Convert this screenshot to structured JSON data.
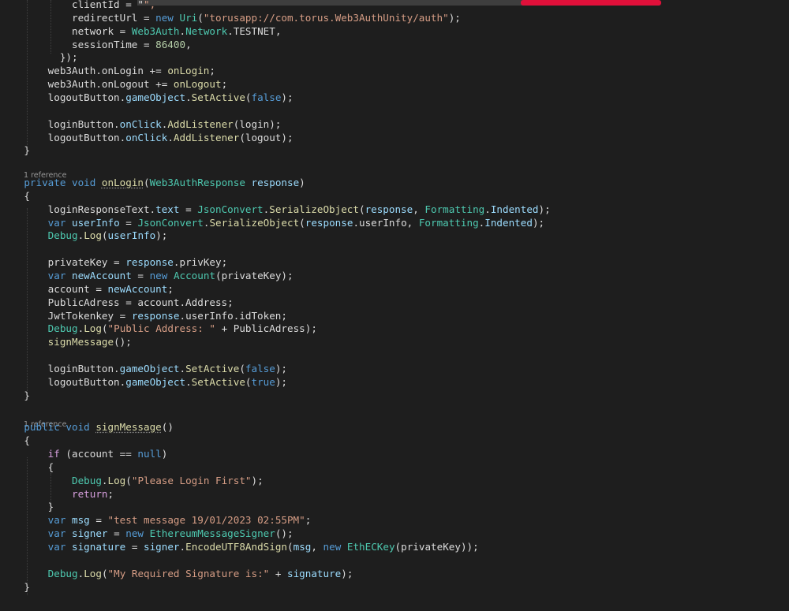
{
  "editor": {
    "code_lens": [
      "1 reference",
      "1 reference"
    ],
    "lines": [
      [
        {
          "t": "            clientId = \"",
          "c": "pl"
        },
        {
          "t": "\",",
          "c": "str"
        }
      ],
      [
        {
          "t": "            redirectUrl = ",
          "c": "pl"
        },
        {
          "t": "new ",
          "c": "kw"
        },
        {
          "t": "Uri",
          "c": "ty"
        },
        {
          "t": "(",
          "c": "pl"
        },
        {
          "t": "\"torusapp://com.torus.Web3AuthUnity/auth\"",
          "c": "str"
        },
        {
          "t": ");",
          "c": "pl"
        }
      ],
      [
        {
          "t": "            network = ",
          "c": "pl"
        },
        {
          "t": "Web3Auth",
          "c": "ty"
        },
        {
          "t": ".",
          "c": "pl"
        },
        {
          "t": "Network",
          "c": "ty"
        },
        {
          "t": ".TESTNET,",
          "c": "pl"
        }
      ],
      [
        {
          "t": "            sessionTime = ",
          "c": "pl"
        },
        {
          "t": "86400",
          "c": "num"
        },
        {
          "t": ",",
          "c": "pl"
        }
      ],
      [
        {
          "t": "          });",
          "c": "pl"
        }
      ],
      [
        {
          "t": "        web3Auth.onLogin += ",
          "c": "pl"
        },
        {
          "t": "onLogin",
          "c": "fn"
        },
        {
          "t": ";",
          "c": "pl"
        }
      ],
      [
        {
          "t": "        web3Auth.onLogout += ",
          "c": "pl"
        },
        {
          "t": "onLogout",
          "c": "fn"
        },
        {
          "t": ";",
          "c": "pl"
        }
      ],
      [
        {
          "t": "        logoutButton.",
          "c": "pl"
        },
        {
          "t": "gameObject",
          "c": "var"
        },
        {
          "t": ".",
          "c": "pl"
        },
        {
          "t": "SetActive",
          "c": "fn"
        },
        {
          "t": "(",
          "c": "pl"
        },
        {
          "t": "false",
          "c": "kw"
        },
        {
          "t": ");",
          "c": "pl"
        }
      ],
      [],
      [
        {
          "t": "        loginButton.",
          "c": "pl"
        },
        {
          "t": "onClick",
          "c": "var"
        },
        {
          "t": ".",
          "c": "pl"
        },
        {
          "t": "AddListener",
          "c": "fn"
        },
        {
          "t": "(login);",
          "c": "pl"
        }
      ],
      [
        {
          "t": "        logoutButton.",
          "c": "pl"
        },
        {
          "t": "onClick",
          "c": "var"
        },
        {
          "t": ".",
          "c": "pl"
        },
        {
          "t": "AddListener",
          "c": "fn"
        },
        {
          "t": "(logout);",
          "c": "pl"
        }
      ],
      [
        {
          "t": "    }",
          "c": "pl"
        }
      ],
      [],
      [
        {
          "t": "    ",
          "c": "pl"
        },
        {
          "t": "private void ",
          "c": "kw"
        },
        {
          "t": "onLogin",
          "c": "fn"
        },
        {
          "t": "(",
          "c": "pl"
        },
        {
          "t": "Web3AuthResponse ",
          "c": "ty"
        },
        {
          "t": "response",
          "c": "var"
        },
        {
          "t": ")",
          "c": "pl"
        }
      ],
      [
        {
          "t": "    {",
          "c": "pl"
        }
      ],
      [
        {
          "t": "        loginResponseText.",
          "c": "pl"
        },
        {
          "t": "text",
          "c": "var"
        },
        {
          "t": " = ",
          "c": "pl"
        },
        {
          "t": "JsonConvert",
          "c": "ty"
        },
        {
          "t": ".",
          "c": "pl"
        },
        {
          "t": "SerializeObject",
          "c": "fn"
        },
        {
          "t": "(",
          "c": "pl"
        },
        {
          "t": "response",
          "c": "var"
        },
        {
          "t": ", ",
          "c": "pl"
        },
        {
          "t": "Formatting",
          "c": "ty"
        },
        {
          "t": ".",
          "c": "pl"
        },
        {
          "t": "Indented",
          "c": "var"
        },
        {
          "t": ");",
          "c": "pl"
        }
      ],
      [
        {
          "t": "        ",
          "c": "pl"
        },
        {
          "t": "var ",
          "c": "kw"
        },
        {
          "t": "userInfo",
          "c": "var"
        },
        {
          "t": " = ",
          "c": "pl"
        },
        {
          "t": "JsonConvert",
          "c": "ty"
        },
        {
          "t": ".",
          "c": "pl"
        },
        {
          "t": "SerializeObject",
          "c": "fn"
        },
        {
          "t": "(",
          "c": "pl"
        },
        {
          "t": "response",
          "c": "var"
        },
        {
          "t": ".userInfo, ",
          "c": "pl"
        },
        {
          "t": "Formatting",
          "c": "ty"
        },
        {
          "t": ".",
          "c": "pl"
        },
        {
          "t": "Indented",
          "c": "var"
        },
        {
          "t": ");",
          "c": "pl"
        }
      ],
      [
        {
          "t": "        ",
          "c": "pl"
        },
        {
          "t": "Debug",
          "c": "ty"
        },
        {
          "t": ".",
          "c": "pl"
        },
        {
          "t": "Log",
          "c": "fn"
        },
        {
          "t": "(",
          "c": "pl"
        },
        {
          "t": "userInfo",
          "c": "var"
        },
        {
          "t": ");",
          "c": "pl"
        }
      ],
      [],
      [
        {
          "t": "        privateKey = ",
          "c": "pl"
        },
        {
          "t": "response",
          "c": "var"
        },
        {
          "t": ".privKey;",
          "c": "pl"
        }
      ],
      [
        {
          "t": "        ",
          "c": "pl"
        },
        {
          "t": "var ",
          "c": "kw"
        },
        {
          "t": "newAccount",
          "c": "var"
        },
        {
          "t": " = ",
          "c": "pl"
        },
        {
          "t": "new ",
          "c": "kw"
        },
        {
          "t": "Account",
          "c": "ty"
        },
        {
          "t": "(privateKey);",
          "c": "pl"
        }
      ],
      [
        {
          "t": "        account = ",
          "c": "pl"
        },
        {
          "t": "newAccount",
          "c": "var"
        },
        {
          "t": ";",
          "c": "pl"
        }
      ],
      [
        {
          "t": "        PublicAdress = account.Address;",
          "c": "pl"
        }
      ],
      [
        {
          "t": "        JwtTokenkey = ",
          "c": "pl"
        },
        {
          "t": "response",
          "c": "var"
        },
        {
          "t": ".userInfo.idToken;",
          "c": "pl"
        }
      ],
      [
        {
          "t": "        ",
          "c": "pl"
        },
        {
          "t": "Debug",
          "c": "ty"
        },
        {
          "t": ".",
          "c": "pl"
        },
        {
          "t": "Log",
          "c": "fn"
        },
        {
          "t": "(",
          "c": "pl"
        },
        {
          "t": "\"Public Address: \"",
          "c": "str"
        },
        {
          "t": " + PublicAdress);",
          "c": "pl"
        }
      ],
      [
        {
          "t": "        ",
          "c": "pl"
        },
        {
          "t": "signMessage",
          "c": "fn"
        },
        {
          "t": "();",
          "c": "pl"
        }
      ],
      [],
      [
        {
          "t": "        loginButton.",
          "c": "pl"
        },
        {
          "t": "gameObject",
          "c": "var"
        },
        {
          "t": ".",
          "c": "pl"
        },
        {
          "t": "SetActive",
          "c": "fn"
        },
        {
          "t": "(",
          "c": "pl"
        },
        {
          "t": "false",
          "c": "kw"
        },
        {
          "t": ");",
          "c": "pl"
        }
      ],
      [
        {
          "t": "        logoutButton.",
          "c": "pl"
        },
        {
          "t": "gameObject",
          "c": "var"
        },
        {
          "t": ".",
          "c": "pl"
        },
        {
          "t": "SetActive",
          "c": "fn"
        },
        {
          "t": "(",
          "c": "pl"
        },
        {
          "t": "true",
          "c": "kw"
        },
        {
          "t": ");",
          "c": "pl"
        }
      ],
      [
        {
          "t": "    }",
          "c": "pl"
        }
      ],
      [],
      [
        {
          "t": "    ",
          "c": "pl"
        },
        {
          "t": "public void ",
          "c": "kw"
        },
        {
          "t": "signMessage",
          "c": "fn"
        },
        {
          "t": "()",
          "c": "pl"
        }
      ],
      [
        {
          "t": "    {",
          "c": "pl"
        }
      ],
      [
        {
          "t": "        ",
          "c": "pl"
        },
        {
          "t": "if",
          "c": "ctl"
        },
        {
          "t": " (account == ",
          "c": "pl"
        },
        {
          "t": "null",
          "c": "kw"
        },
        {
          "t": ")",
          "c": "pl"
        }
      ],
      [
        {
          "t": "        {",
          "c": "pl"
        }
      ],
      [
        {
          "t": "            ",
          "c": "pl"
        },
        {
          "t": "Debug",
          "c": "ty"
        },
        {
          "t": ".",
          "c": "pl"
        },
        {
          "t": "Log",
          "c": "fn"
        },
        {
          "t": "(",
          "c": "pl"
        },
        {
          "t": "\"Please Login First\"",
          "c": "str"
        },
        {
          "t": ");",
          "c": "pl"
        }
      ],
      [
        {
          "t": "            ",
          "c": "pl"
        },
        {
          "t": "return",
          "c": "ctl"
        },
        {
          "t": ";",
          "c": "pl"
        }
      ],
      [
        {
          "t": "        }",
          "c": "pl"
        }
      ],
      [
        {
          "t": "        ",
          "c": "pl"
        },
        {
          "t": "var ",
          "c": "kw"
        },
        {
          "t": "msg",
          "c": "var"
        },
        {
          "t": " = ",
          "c": "pl"
        },
        {
          "t": "\"test message 19/01/2023 02:55PM\"",
          "c": "str"
        },
        {
          "t": ";",
          "c": "pl"
        }
      ],
      [
        {
          "t": "        ",
          "c": "pl"
        },
        {
          "t": "var ",
          "c": "kw"
        },
        {
          "t": "signer",
          "c": "var"
        },
        {
          "t": " = ",
          "c": "pl"
        },
        {
          "t": "new ",
          "c": "kw"
        },
        {
          "t": "EthereumMessageSigner",
          "c": "ty"
        },
        {
          "t": "();",
          "c": "pl"
        }
      ],
      [
        {
          "t": "        ",
          "c": "pl"
        },
        {
          "t": "var ",
          "c": "kw"
        },
        {
          "t": "signature",
          "c": "var"
        },
        {
          "t": " = ",
          "c": "pl"
        },
        {
          "t": "signer",
          "c": "var"
        },
        {
          "t": ".",
          "c": "pl"
        },
        {
          "t": "EncodeUTF8AndSign",
          "c": "fn"
        },
        {
          "t": "(",
          "c": "pl"
        },
        {
          "t": "msg",
          "c": "var"
        },
        {
          "t": ", ",
          "c": "pl"
        },
        {
          "t": "new ",
          "c": "kw"
        },
        {
          "t": "EthECKey",
          "c": "ty"
        },
        {
          "t": "(privateKey));",
          "c": "pl"
        }
      ],
      [],
      [
        {
          "t": "        ",
          "c": "pl"
        },
        {
          "t": "Debug",
          "c": "ty"
        },
        {
          "t": ".",
          "c": "pl"
        },
        {
          "t": "Log",
          "c": "fn"
        },
        {
          "t": "(",
          "c": "pl"
        },
        {
          "t": "\"My Required Signature is:\"",
          "c": "str"
        },
        {
          "t": " + ",
          "c": "pl"
        },
        {
          "t": "signature",
          "c": "var"
        },
        {
          "t": ");",
          "c": "pl"
        }
      ],
      [
        {
          "t": "    }",
          "c": "pl"
        }
      ]
    ]
  }
}
